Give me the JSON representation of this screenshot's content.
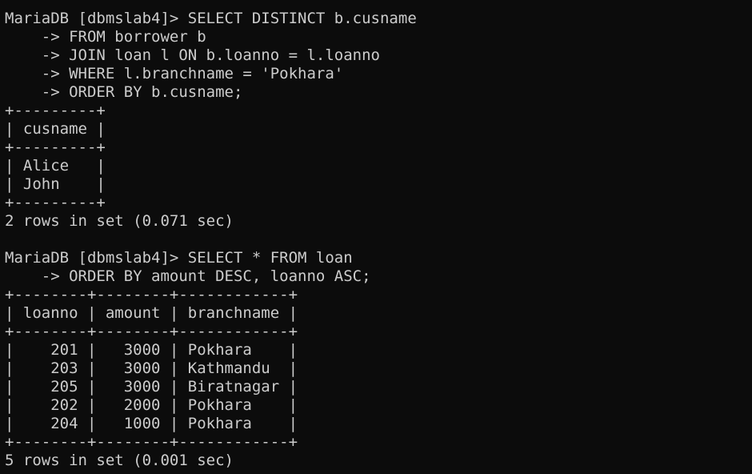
{
  "terminal": {
    "theme": {
      "background": "#0c0c0c",
      "foreground": "#cccccc"
    },
    "lines": [
      "MariaDB [dbmslab4]> SELECT DISTINCT b.cusname",
      "    -> FROM borrower b",
      "    -> JOIN loan l ON b.loanno = l.loanno",
      "    -> WHERE l.branchname = 'Pokhara'",
      "    -> ORDER BY b.cusname;",
      "+---------+",
      "| cusname |",
      "+---------+",
      "| Alice   |",
      "| John    |",
      "+---------+",
      "2 rows in set (0.071 sec)",
      "",
      "MariaDB [dbmslab4]> SELECT * FROM loan",
      "    -> ORDER BY amount DESC, loanno ASC;",
      "+--------+--------+------------+",
      "| loanno | amount | branchname |",
      "+--------+--------+------------+",
      "|    201 |   3000 | Pokhara    |",
      "|    203 |   3000 | Kathmandu  |",
      "|    205 |   3000 | Biratnagar |",
      "|    202 |   2000 | Pokhara    |",
      "|    204 |   1000 | Pokhara    |",
      "+--------+--------+------------+",
      "5 rows in set (0.001 sec)"
    ]
  }
}
